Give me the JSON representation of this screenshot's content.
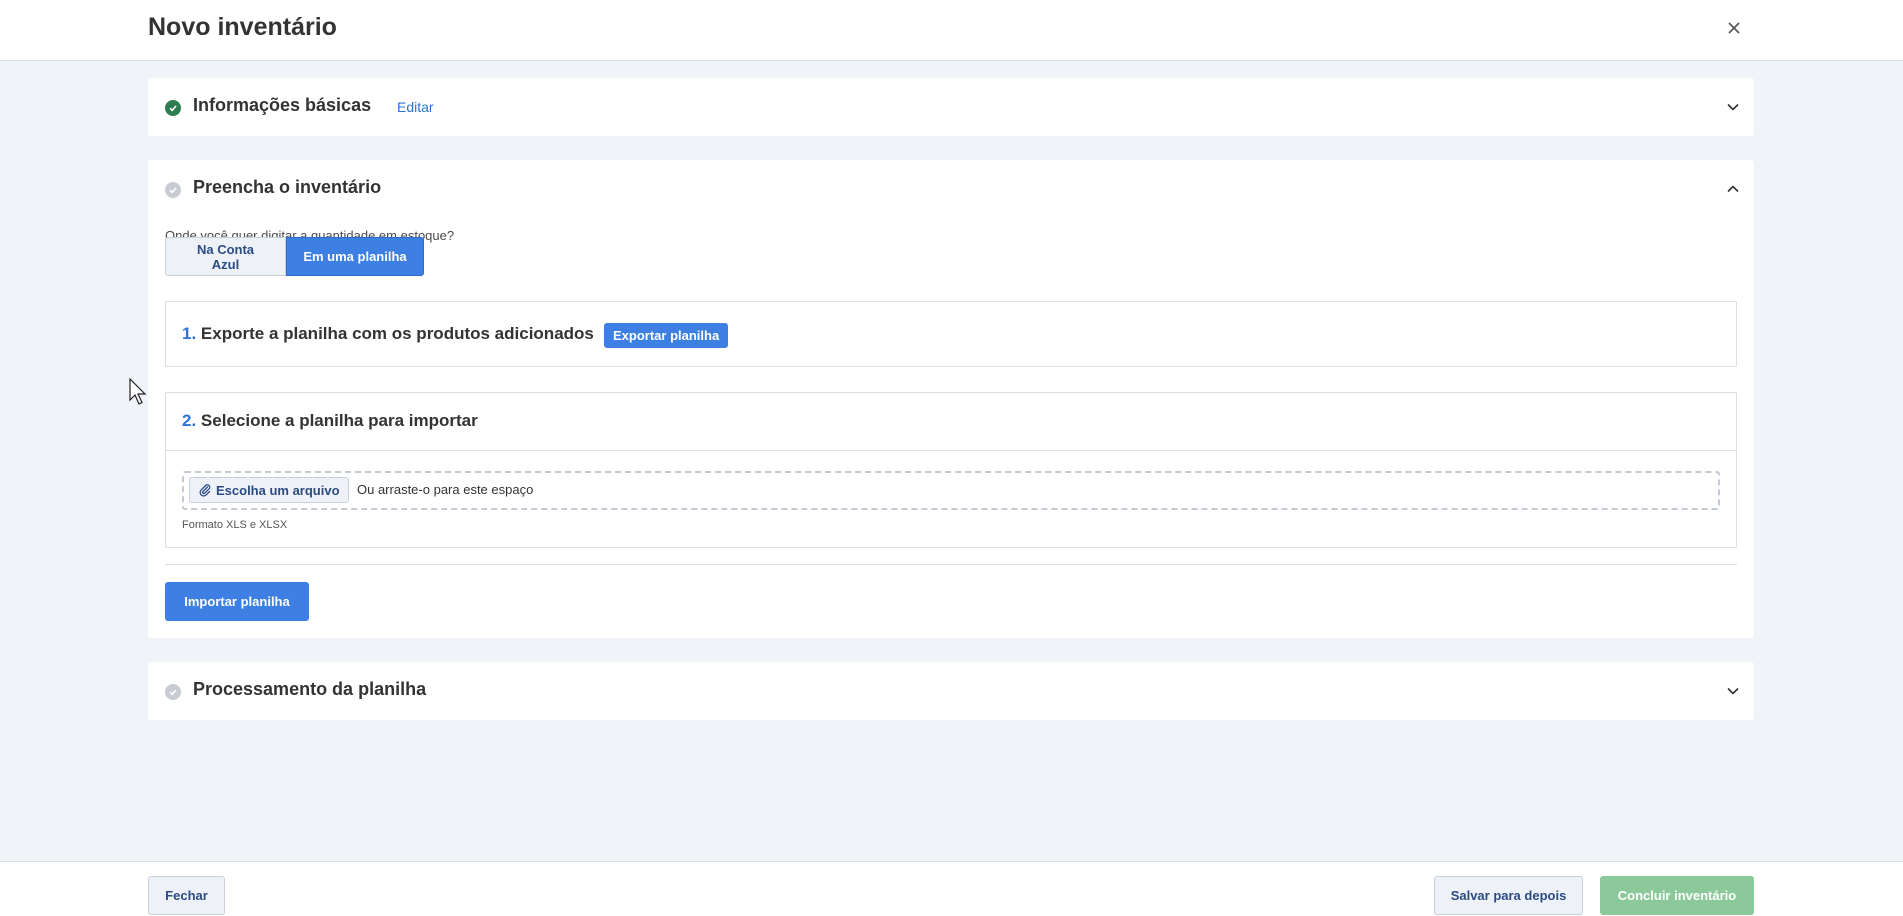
{
  "header": {
    "title": "Novo inventário",
    "close_icon": "close-icon"
  },
  "section_basic": {
    "title": "Informações básicas",
    "edit_label": "Editar",
    "status": "done",
    "expanded": false
  },
  "section_fill": {
    "title": "Preencha o inventário",
    "status": "pending",
    "expanded": true,
    "question": "Onde você quer digitar a quantidade em estoque?",
    "options": [
      {
        "label": "Na Conta Azul",
        "selected": false
      },
      {
        "label": "Em uma planilha",
        "selected": true
      }
    ],
    "step1": {
      "number": "1.",
      "title": "Exporte a planilha com os produtos adicionados",
      "button_label": "Exportar planilha"
    },
    "step2": {
      "number": "2.",
      "title": "Selecione a planilha para importar",
      "choose_label": "Escolha um arquivo",
      "drop_text": "Ou arraste-o para este espaço",
      "format_hint": "Formato XLS e XLSX"
    },
    "import_label": "Importar planilha"
  },
  "section_processing": {
    "title": "Processamento da planilha",
    "status": "pending",
    "expanded": false
  },
  "footer": {
    "close_label": "Fechar",
    "save_label": "Salvar para depois",
    "conclude_label": "Concluir inventário"
  },
  "colors": {
    "primary": "#3d7fe3",
    "success": "#2e7d4f",
    "conclude_disabled": "#8bc99a",
    "background": "#f0f3f8"
  }
}
